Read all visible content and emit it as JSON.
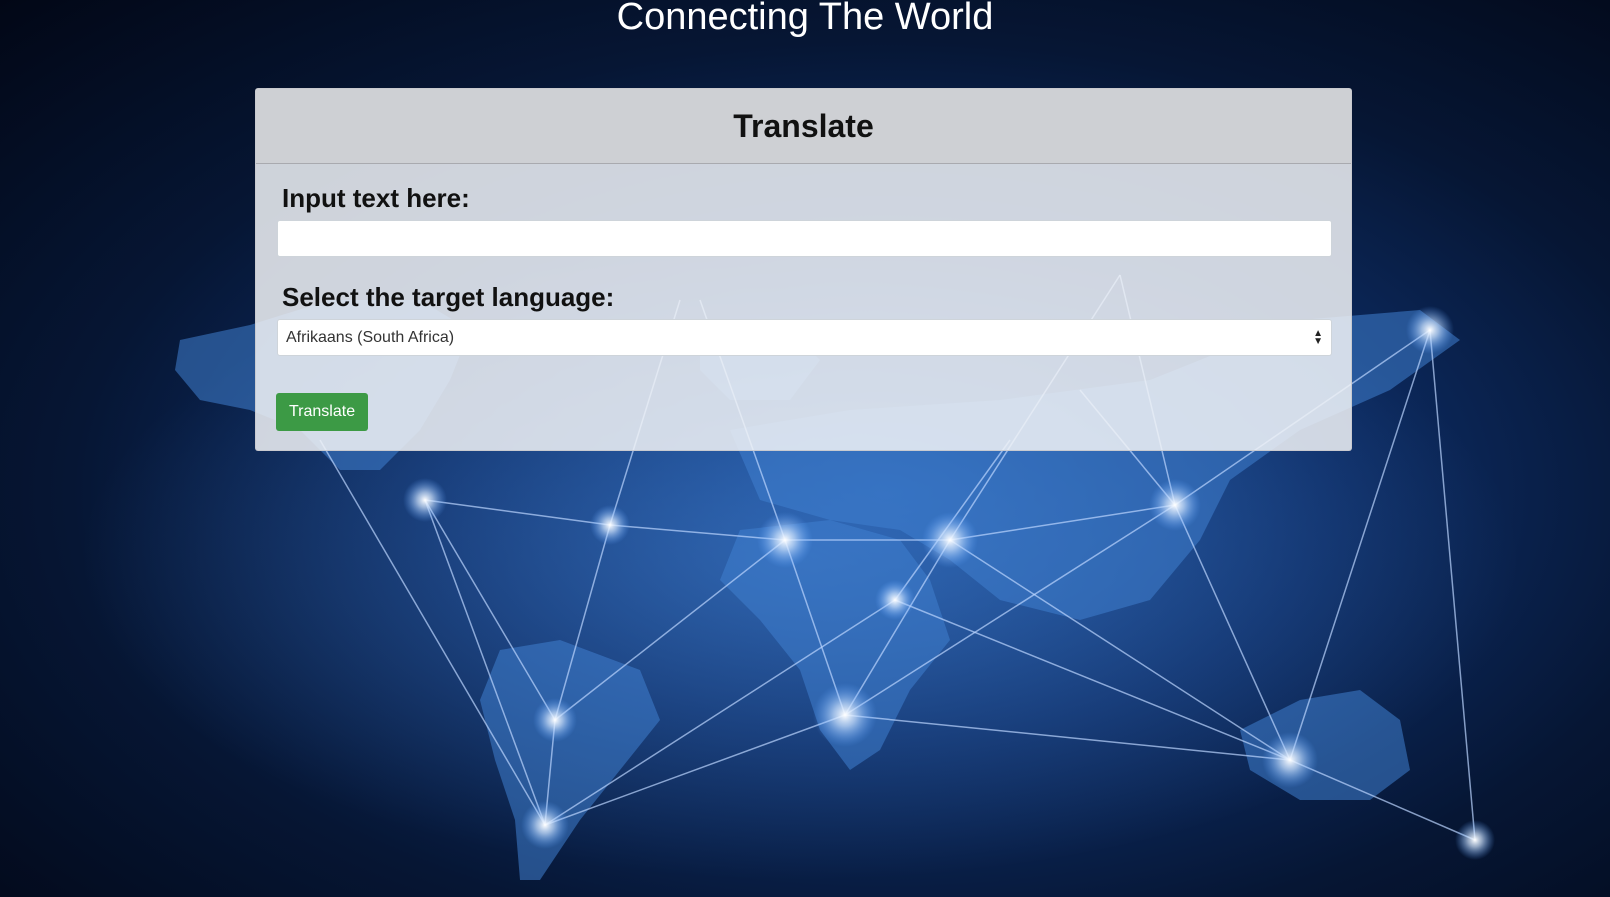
{
  "page": {
    "title": "Connecting The World"
  },
  "card": {
    "title": "Translate",
    "input_label": "Input text here:",
    "input_value": "",
    "language_label": "Select the target language:",
    "language_selected": "Afrikaans (South Africa)",
    "submit_label": "Translate"
  },
  "colors": {
    "background": "#061634",
    "button": "#3c9a45",
    "card_header": "#cdcfd4"
  },
  "icons": {
    "select": "updown-arrows-icon"
  }
}
